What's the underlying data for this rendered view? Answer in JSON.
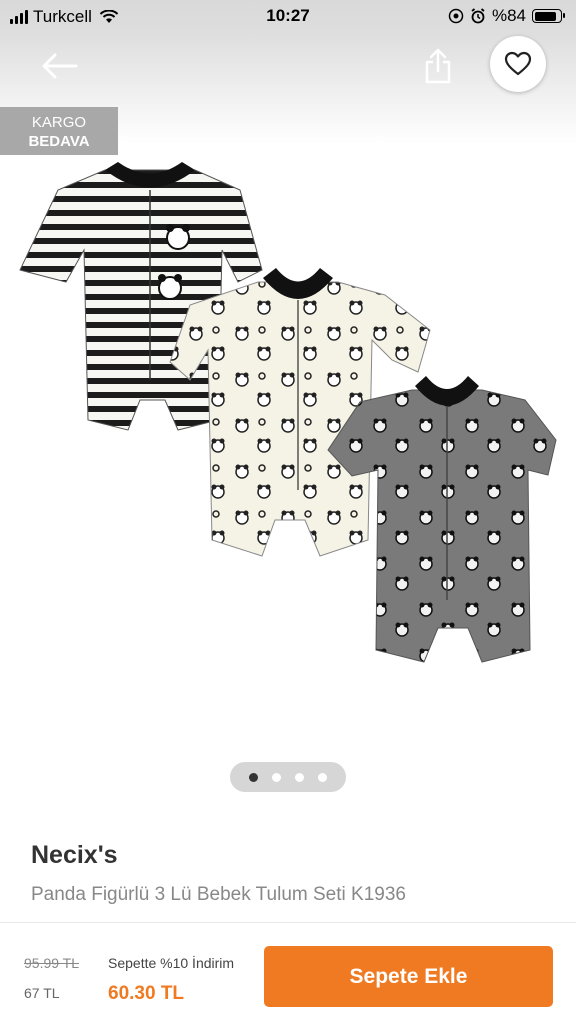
{
  "status_bar": {
    "carrier": "Turkcell",
    "time": "10:27",
    "battery": "%84"
  },
  "header": {
    "back_icon": "arrow-left-icon",
    "share_icon": "share-icon",
    "favorite_icon": "heart-icon"
  },
  "badge": {
    "line1": "KARGO",
    "line2": "BEDAVA"
  },
  "gallery": {
    "image_count": 4,
    "active_index": 0
  },
  "product": {
    "brand": "Necix's",
    "name": "Panda Figürlü 3 Lü Bebek Tulum Seti K1936"
  },
  "price": {
    "old": "95.99 TL",
    "unit": "67 TL",
    "discount_label": "Sepette %10 İndirim",
    "new": "60.30 TL"
  },
  "actions": {
    "add_to_cart": "Sepete Ekle"
  },
  "colors": {
    "accent": "#f07a22",
    "badge": "#a8a8a8"
  }
}
